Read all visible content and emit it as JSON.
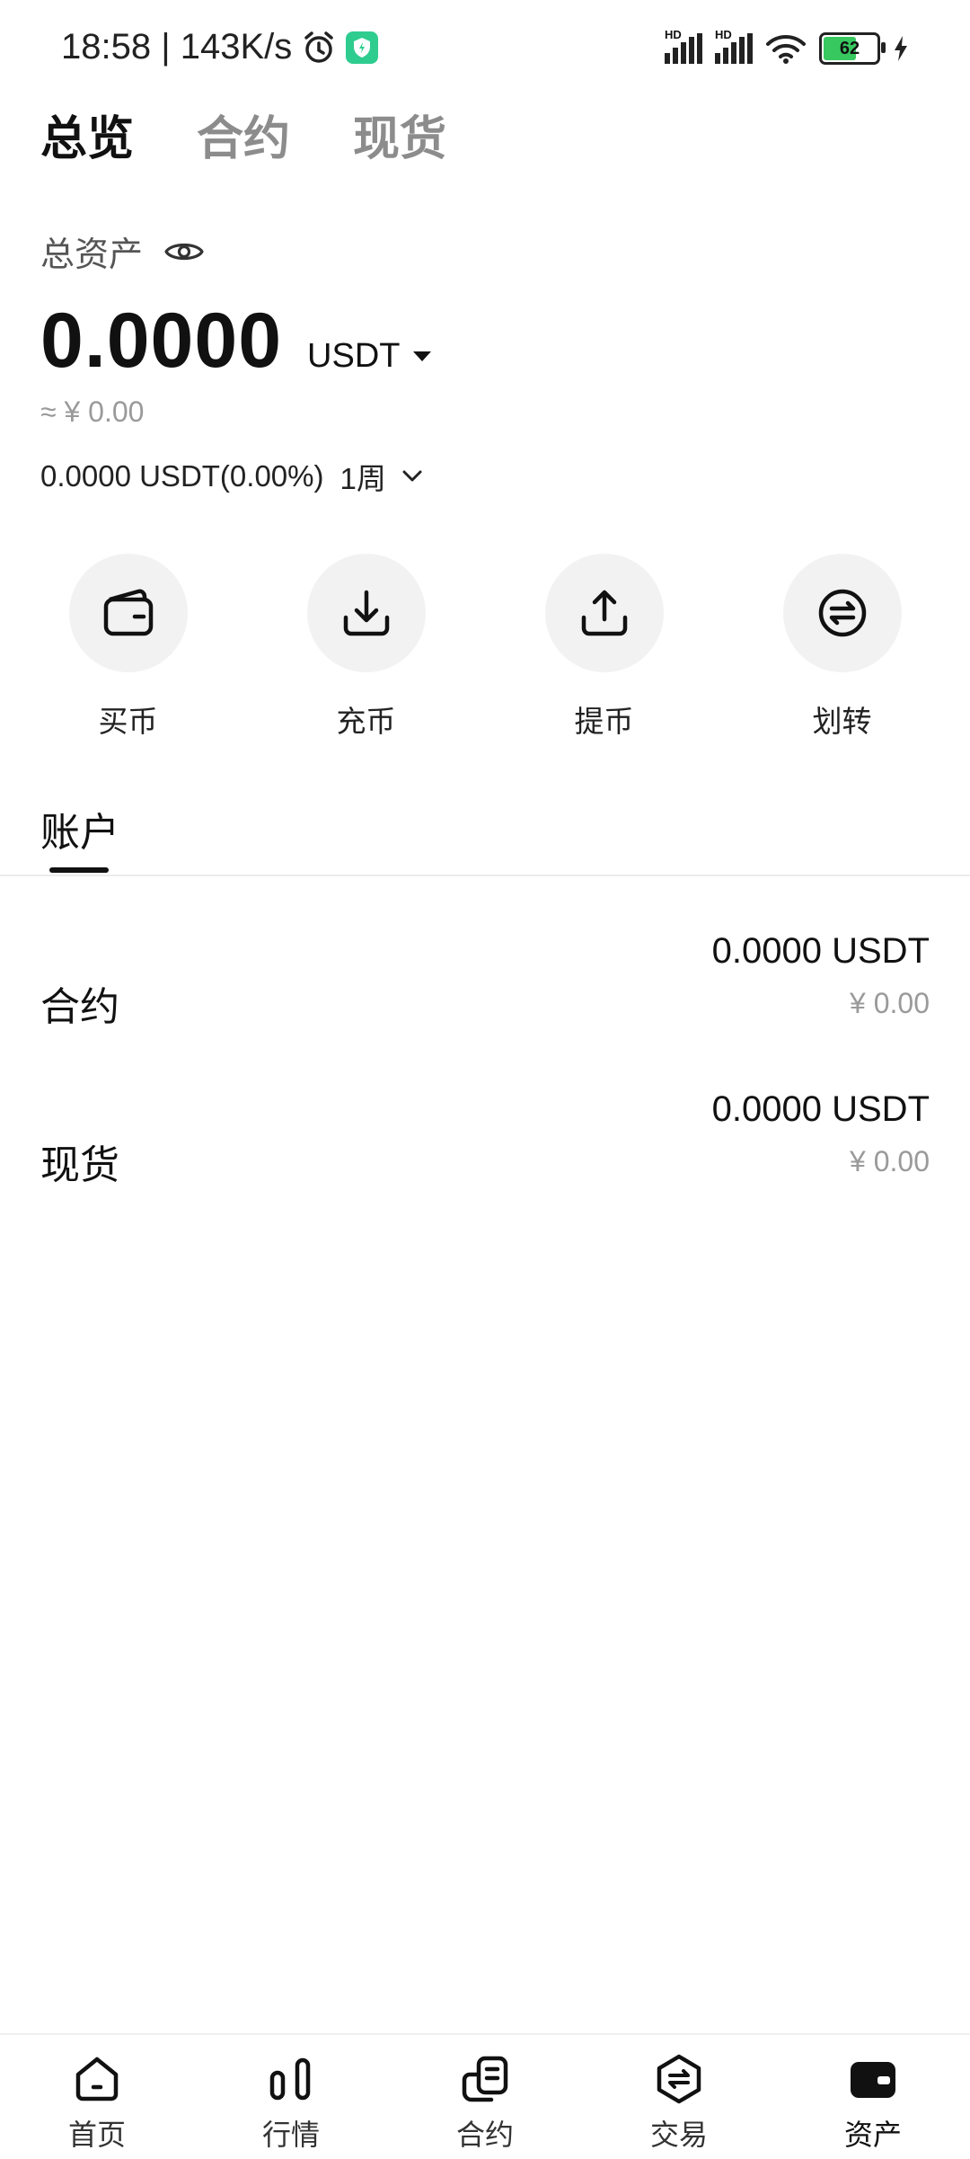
{
  "status_bar": {
    "time_speed": "18:58 | 143K/s",
    "battery": "62",
    "hd1": "HD",
    "hd2": "HD"
  },
  "top_tabs": [
    {
      "label": "总览",
      "active": true
    },
    {
      "label": "合约",
      "active": false
    },
    {
      "label": "现货",
      "active": false
    }
  ],
  "overview": {
    "total_assets_label": "总资产",
    "balance": "0.0000",
    "unit": "USDT",
    "approx_cny": "≈ ¥ 0.00",
    "pnl": "0.0000 USDT(0.00%)",
    "period": "1周"
  },
  "actions": [
    {
      "label": "买币",
      "icon": "wallet-icon"
    },
    {
      "label": "充币",
      "icon": "deposit-icon"
    },
    {
      "label": "提币",
      "icon": "withdraw-icon"
    },
    {
      "label": "划转",
      "icon": "transfer-icon"
    }
  ],
  "accounts": {
    "tab_label": "账户",
    "rows": [
      {
        "name": "合约",
        "amount": "0.0000 USDT",
        "cny": "¥ 0.00"
      },
      {
        "name": "现货",
        "amount": "0.0000 USDT",
        "cny": "¥ 0.00"
      }
    ]
  },
  "bottom_nav": [
    {
      "label": "首页",
      "icon": "home-icon"
    },
    {
      "label": "行情",
      "icon": "market-icon"
    },
    {
      "label": "合约",
      "icon": "contract-icon"
    },
    {
      "label": "交易",
      "icon": "trade-icon"
    },
    {
      "label": "资产",
      "icon": "assets-icon",
      "active": true
    }
  ],
  "colors": {
    "accent": "#111111",
    "muted": "#9a9a9a",
    "circle_bg": "#f2f2f2",
    "battery_fill": "#37c860",
    "app_badge": "#2ecc8f"
  }
}
